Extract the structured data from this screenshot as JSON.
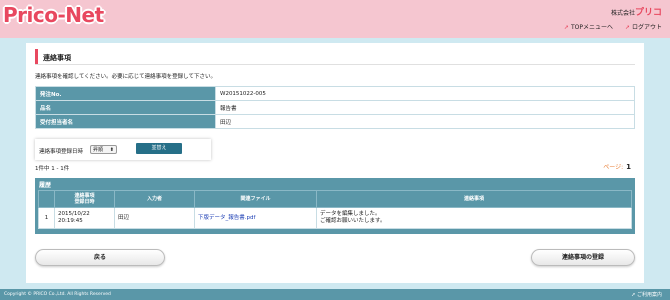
{
  "header": {
    "logo": "Prico-Net",
    "company_prefix": "株式会社",
    "company_name": "プリコ",
    "links": [
      {
        "arrow": "➚",
        "label": "TOPメニューへ"
      },
      {
        "arrow": "➚",
        "label": "ログアウト"
      }
    ]
  },
  "page": {
    "title": "連絡事項",
    "intro": "連絡事項を確認してください。必要に応じて連絡事項を登録して下さい。"
  },
  "info": [
    {
      "label": "発注No.",
      "value": "W20151022-005"
    },
    {
      "label": "品名",
      "value": "報告書"
    },
    {
      "label": "受付担当者名",
      "value": "田辺"
    }
  ],
  "sort": {
    "label": "連絡事項登録日時",
    "selected": "昇順",
    "chevron": "⬍",
    "button": "並替え"
  },
  "results": {
    "count_text": "1件中 1 - 1件",
    "page_label": "ページ:",
    "page_number": "1"
  },
  "history": {
    "title": "履歴",
    "headers": [
      "",
      "連絡事項\n登録日時",
      "入力者",
      "関連ファイル",
      "連絡事項"
    ],
    "rows": [
      {
        "num": "1",
        "datetime_1": "2015/10/22",
        "datetime_2": "20:19:45",
        "author": "田辺",
        "file": "下版データ_報告書.pdf",
        "message_1": "データを編集しました。",
        "message_2": "ご確認お願いいたします。"
      }
    ]
  },
  "buttons": {
    "back": "戻る",
    "register": "連絡事項の登録"
  },
  "footer": {
    "copyright": "Copyright © PRICO Co.,Ltd. All Rights Reserved",
    "guide": "ご利用案内",
    "guide_arrow": "➚"
  }
}
